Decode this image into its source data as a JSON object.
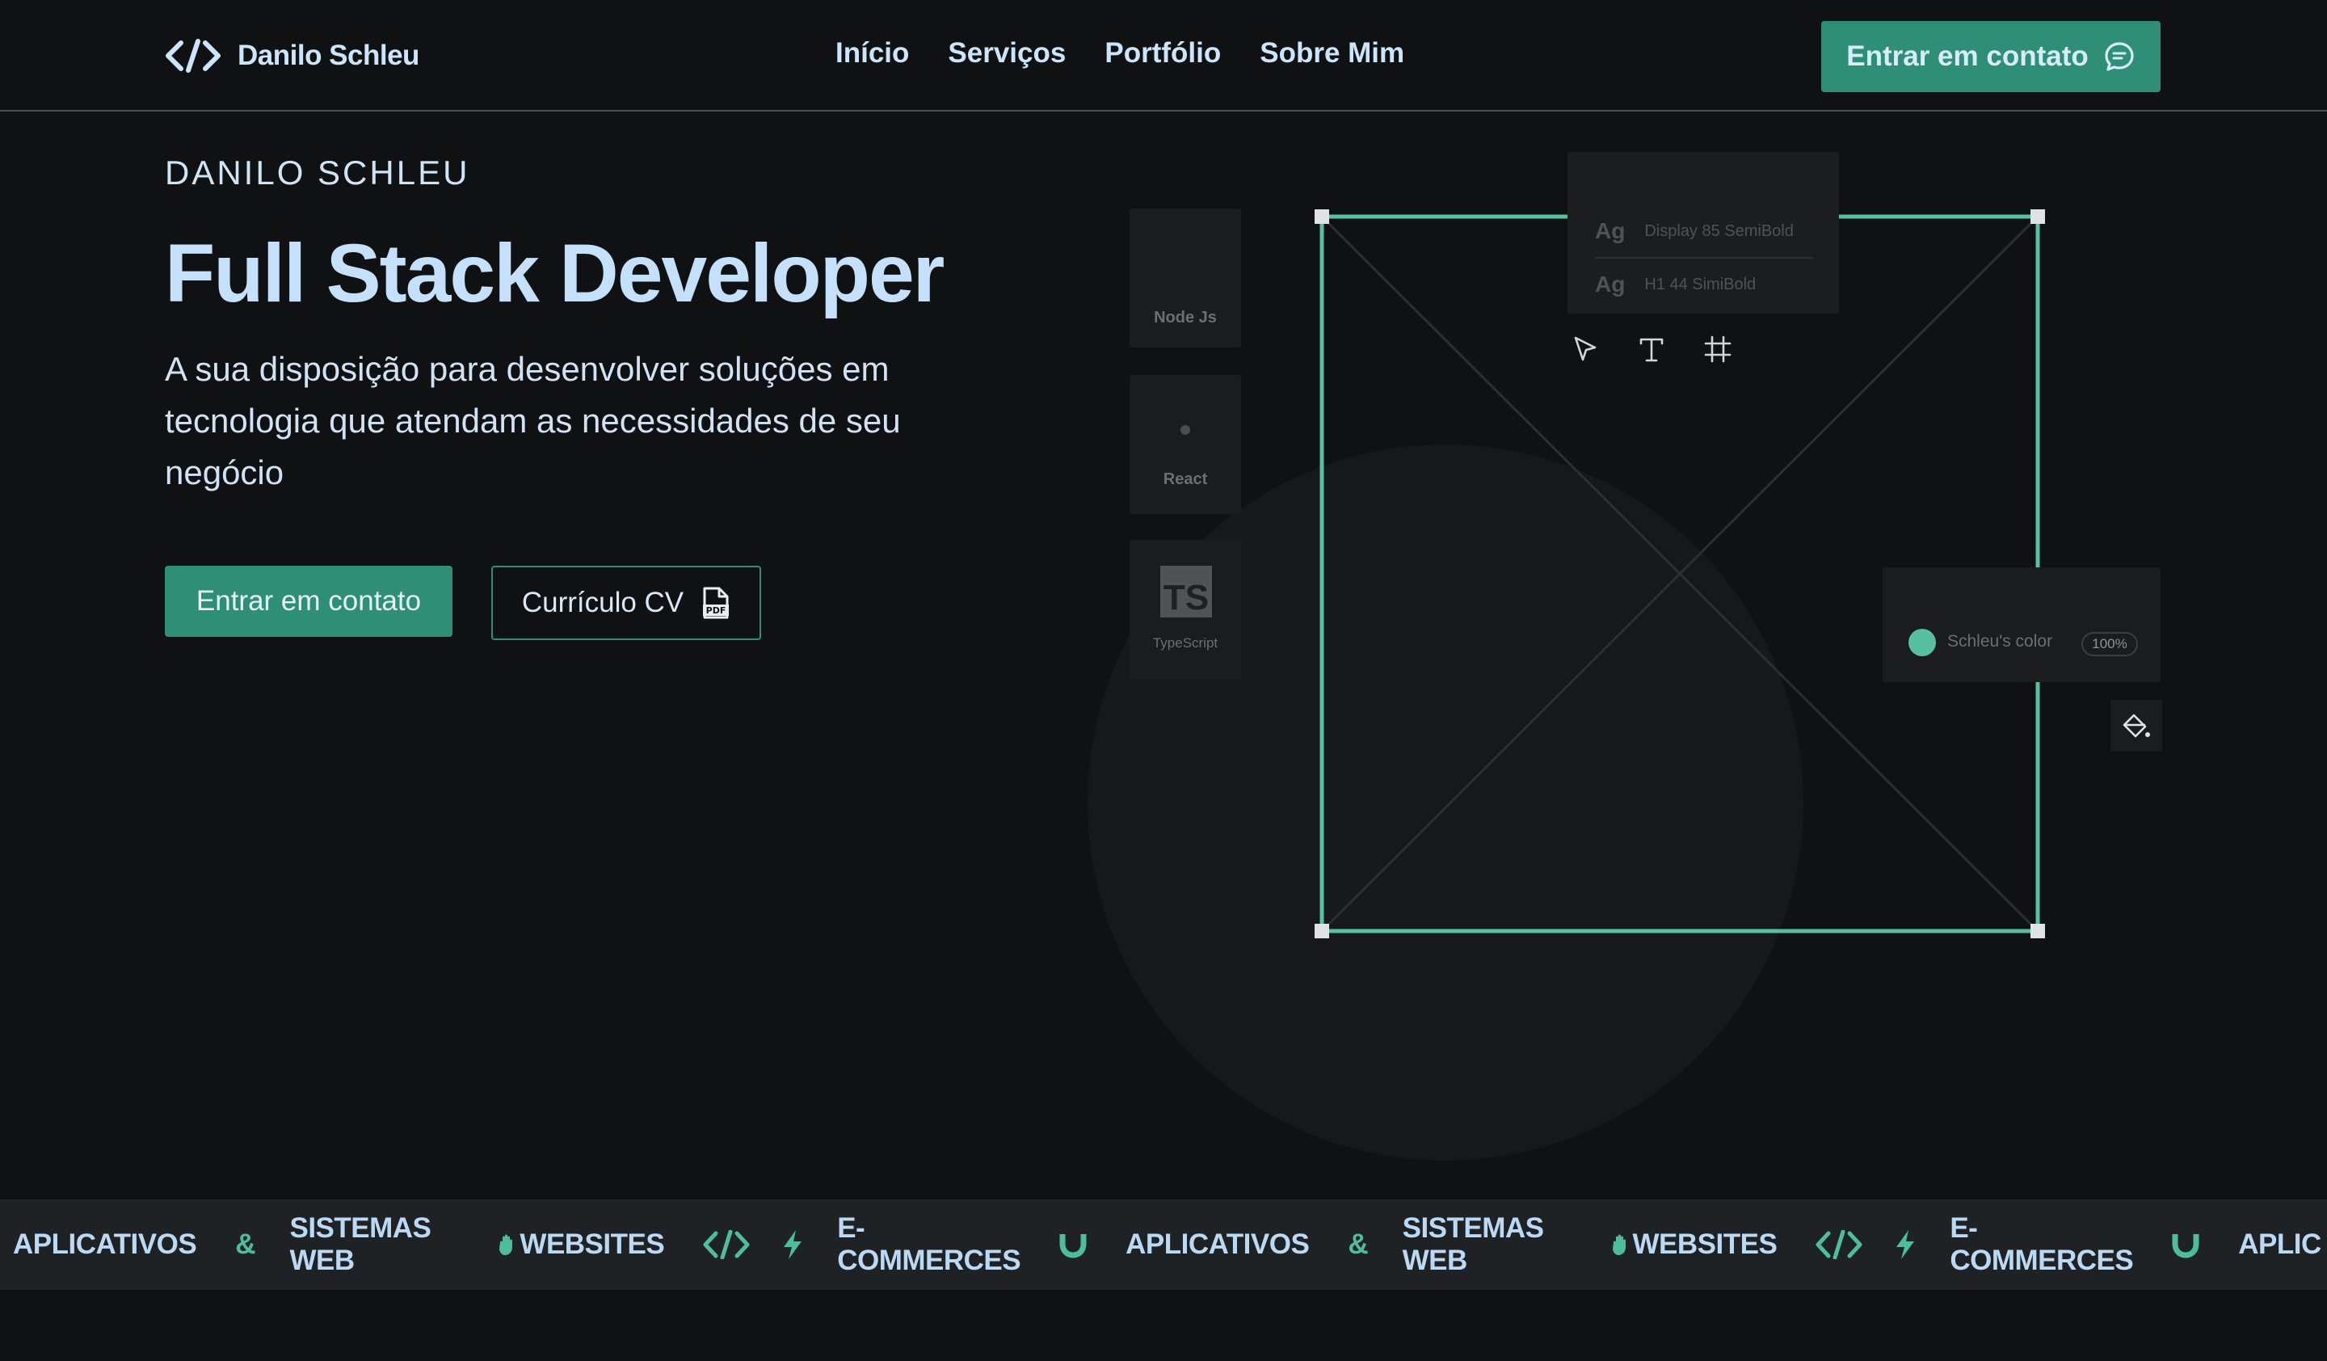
{
  "header": {
    "logo_text": "Danilo Schleu",
    "nav": [
      "Início",
      "Serviços",
      "Portfólio",
      "Sobre Mim"
    ],
    "cta_label": "Entrar em contato"
  },
  "hero": {
    "eyebrow": "DANILO SCHLEU",
    "title": "Full Stack Developer",
    "subtitle": "A sua disposição para desenvolver soluções em tecnologia que atendam as necessidades de seu negócio",
    "primary_button": "Entrar em contato",
    "secondary_button": "Currículo CV"
  },
  "illustration": {
    "tech_cards": [
      "Node Js",
      "React",
      "TypeScript"
    ],
    "ts_badge": "TS",
    "type_styles": [
      {
        "sample": "Ag",
        "name": "Display 85 SemiBold"
      },
      {
        "sample": "Ag",
        "name": "H1 44 SimiBold"
      }
    ],
    "color_name": "Schleu's color",
    "color_percent": "100%",
    "accent_color": "#56c0a0"
  },
  "marquee": {
    "items": [
      "APLICATIVOS",
      "&",
      "SISTEMAS\nWEB",
      "WEBSITES",
      "E-\nCOMMERCES",
      "APLICATIVOS",
      "&",
      "SISTEMAS\nWEB",
      "WEBSITES",
      "E-\nCOMMERCES",
      "APLIC"
    ]
  },
  "colors": {
    "background": "#0f1112",
    "accent": "#2f8f76",
    "heading": "#c4e0fb"
  }
}
